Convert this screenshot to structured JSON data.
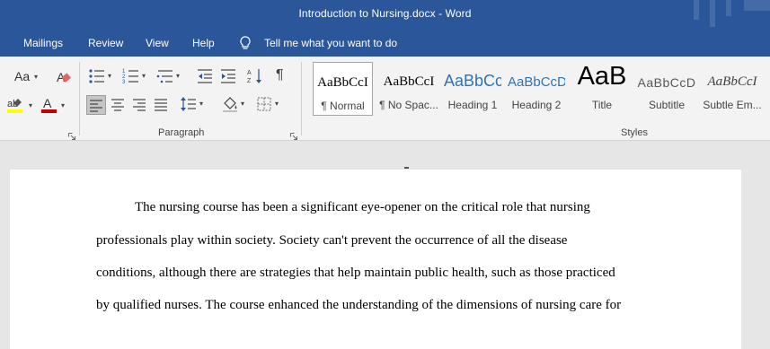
{
  "window": {
    "title": "Introduction to Nursing.docx  -  Word"
  },
  "menu": {
    "items": [
      "Mailings",
      "Review",
      "View",
      "Help"
    ],
    "tell_me": "Tell me what you want to do"
  },
  "ribbon": {
    "font_group": {
      "font_size_label": "Aa"
    },
    "paragraph_group": {
      "label": "Paragraph"
    },
    "styles_group": {
      "label": "Styles",
      "items": [
        {
          "sample": "AaBbCcI",
          "name": "¶ Normal"
        },
        {
          "sample": "AaBbCcI",
          "name": "¶ No Spac..."
        },
        {
          "sample": "AaBbCc",
          "name": "Heading 1"
        },
        {
          "sample": "AaBbCcD",
          "name": "Heading 2"
        },
        {
          "sample": "AaB",
          "name": "Title"
        },
        {
          "sample": "AaBbCcD",
          "name": "Subtitle"
        },
        {
          "sample": "AaBbCcI",
          "name": "Subtle Em..."
        }
      ]
    },
    "colors": {
      "highlight": "#ffff00",
      "font_color": "#c00000",
      "heading_blue": "#2e74b5"
    }
  },
  "document": {
    "lines": [
      "The nursing course has been a significant eye-opener on the critical role that nursing",
      "professionals play within society. Society can't prevent the occurrence of all the disease",
      "conditions, although there are strategies that help maintain public health, such as those practiced",
      "by qualified nurses. The course enhanced the understanding of the dimensions of nursing care for"
    ]
  }
}
